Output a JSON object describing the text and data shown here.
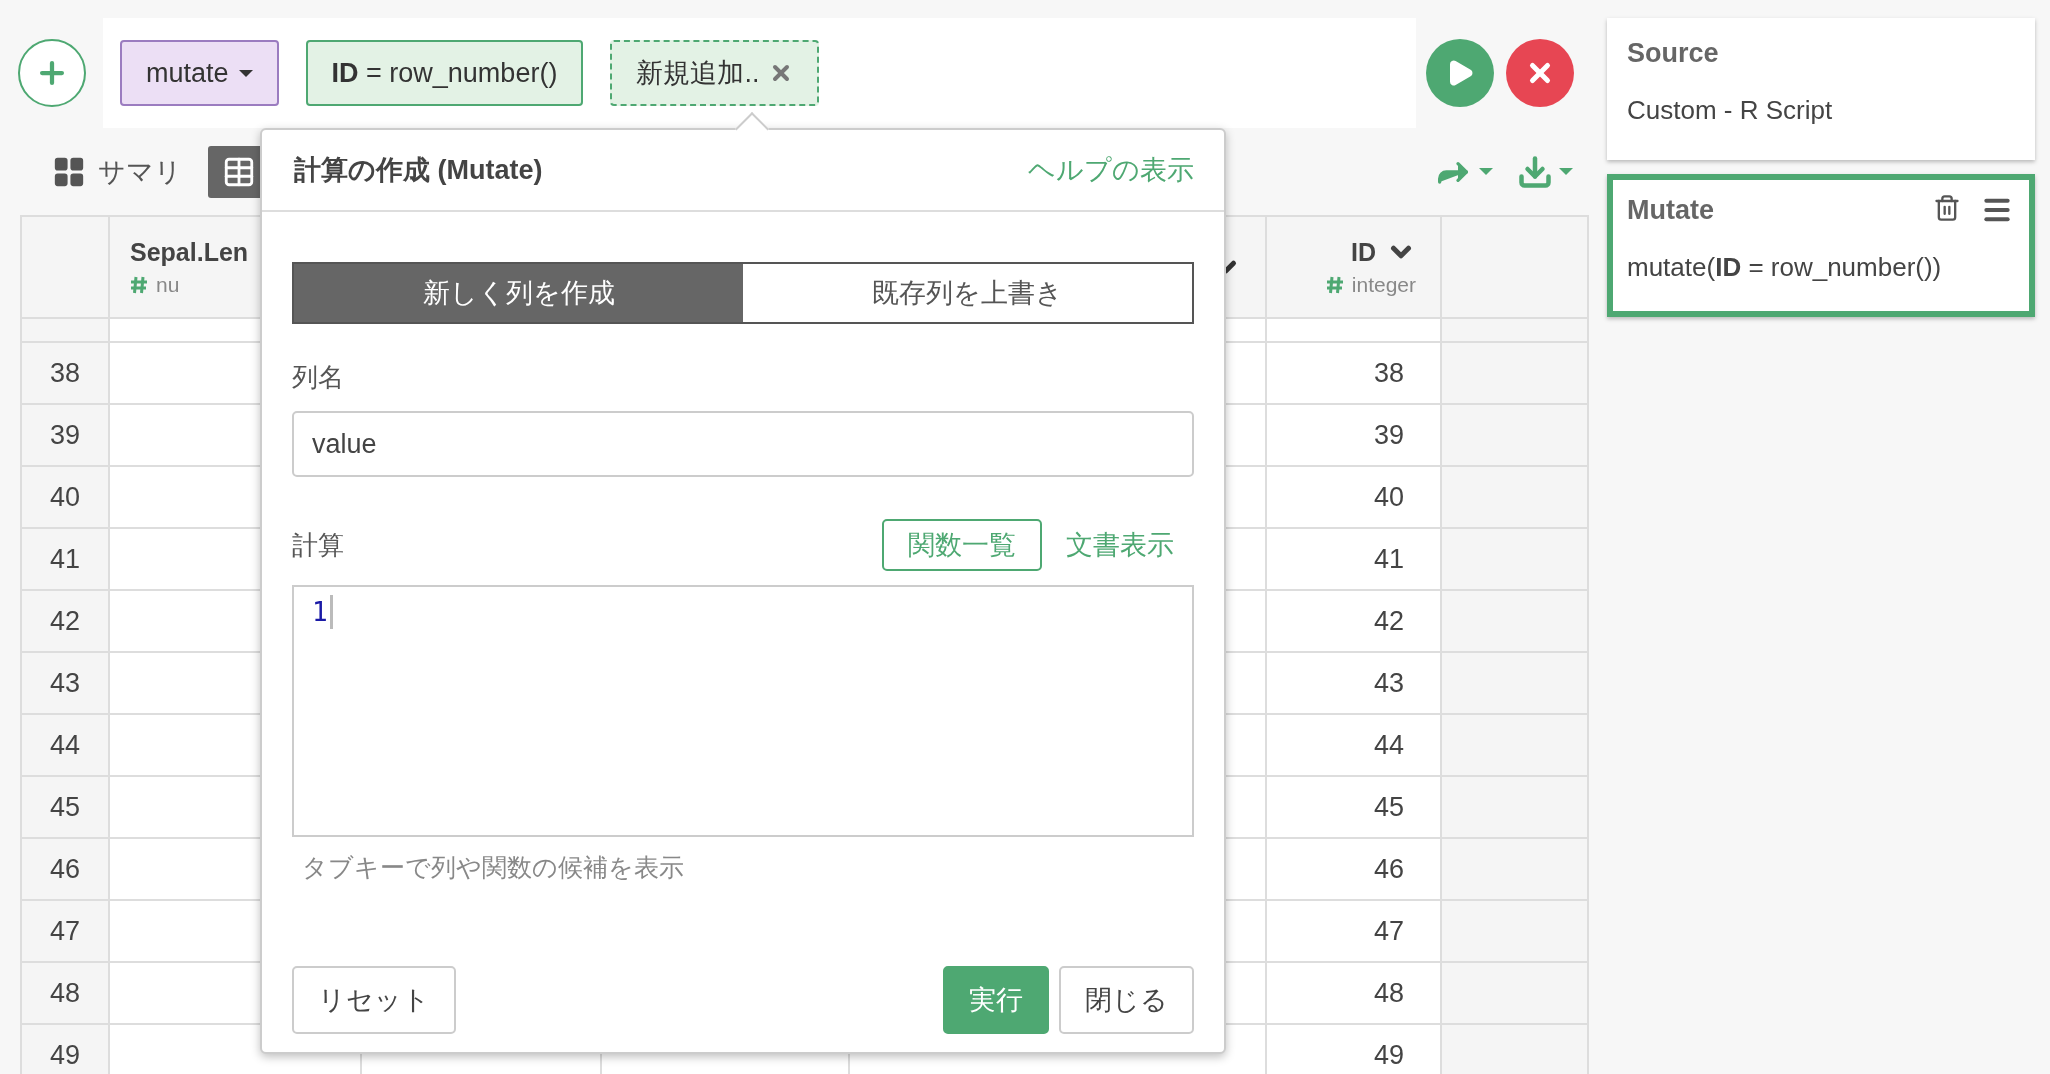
{
  "chips": [
    {
      "kind": "command",
      "label": "mutate"
    },
    {
      "kind": "step",
      "label": "**ID** = row_number()"
    },
    {
      "kind": "pending",
      "label": "新規追加.."
    }
  ],
  "view_tabs": [
    {
      "kind": "summary",
      "label": "サマリ",
      "selected": false
    },
    {
      "kind": "table",
      "selected": true
    }
  ],
  "table": {
    "columns": [
      {
        "kind": "data",
        "name": "Sepal.Len",
        "type": "nu"
      },
      {
        "kind": "covered"
      },
      {
        "kind": "covered"
      },
      {
        "kind": "covered",
        "menu": true
      },
      {
        "kind": "data",
        "name": "ID",
        "type": "integer",
        "menu": true
      },
      {
        "kind": "blank"
      }
    ],
    "rows": [
      {
        "number": "38",
        "id": "38"
      },
      {
        "number": "39",
        "id": "39"
      },
      {
        "number": "40",
        "id": "40"
      },
      {
        "number": "41",
        "id": "41"
      },
      {
        "number": "42",
        "id": "42"
      },
      {
        "number": "43",
        "id": "43"
      },
      {
        "number": "44",
        "id": "44"
      },
      {
        "number": "45",
        "id": "45"
      },
      {
        "number": "46",
        "id": "46"
      },
      {
        "number": "47",
        "id": "47"
      },
      {
        "number": "48",
        "id": "48"
      },
      {
        "number": "49",
        "id": "49"
      }
    ]
  },
  "dialog": {
    "title": "計算の作成 (Mutate)",
    "help_link": "ヘルプの表示",
    "modes": [
      {
        "label": "新しく列を作成",
        "selected": true
      },
      {
        "label": "既存列を上書き",
        "selected": false
      }
    ],
    "name_label": "列名",
    "name_value": "value",
    "calc_label": "計算",
    "function_list_button": "関数一覧",
    "doc_link": "文書表示",
    "code": "1",
    "hint": "タブキーで列や関数の候補を表示",
    "reset_button": "リセット",
    "run_button": "実行",
    "close_button": "閉じる"
  },
  "steps": [
    {
      "title": "Source",
      "detail": "Custom - R Script",
      "selected": false
    },
    {
      "title": "Mutate",
      "detail": "mutate(**ID** = row_number())",
      "selected": true
    }
  ]
}
